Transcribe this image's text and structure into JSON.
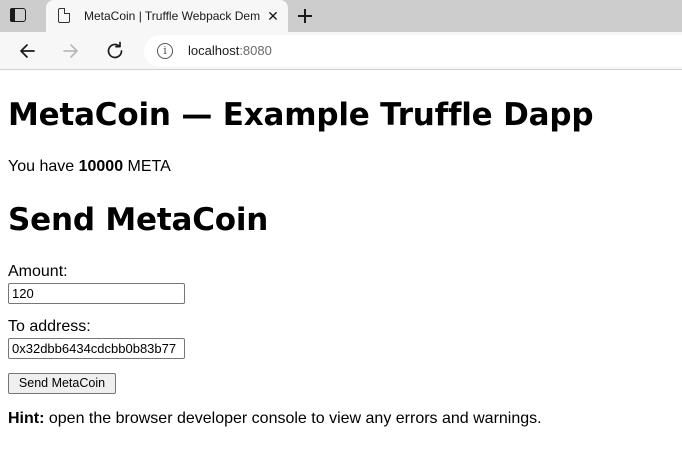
{
  "browser": {
    "tab": {
      "title": "MetaCoin | Truffle Webpack Dem",
      "close_icon": "close-icon",
      "favicon": "document-icon"
    },
    "tab_actions_icon": "tab-actions-icon",
    "new_tab_icon": "plus-icon",
    "nav": {
      "back_icon": "arrow-left-icon",
      "forward_icon": "arrow-right-icon",
      "reload_icon": "reload-icon"
    },
    "address_bar": {
      "info_icon": "info-icon",
      "host": "localhost",
      "port": ":8080"
    }
  },
  "page": {
    "heading": "MetaCoin — Example Truffle Dapp",
    "balance": {
      "prefix": "You have ",
      "amount": "10000",
      "suffix": " META"
    },
    "send_heading": "Send MetaCoin",
    "amount": {
      "label": "Amount:",
      "value": "120"
    },
    "address": {
      "label": "To address:",
      "value": "0x32dbb6434cdcbb0b83b77"
    },
    "send_button": "Send MetaCoin",
    "hint": {
      "label": "Hint:",
      "text": " open the browser developer console to view any errors and warnings."
    }
  },
  "colors": {
    "tabstrip": "#cdcdcd",
    "toolbar": "#f7f7f7",
    "button_bg": "#efefef"
  }
}
